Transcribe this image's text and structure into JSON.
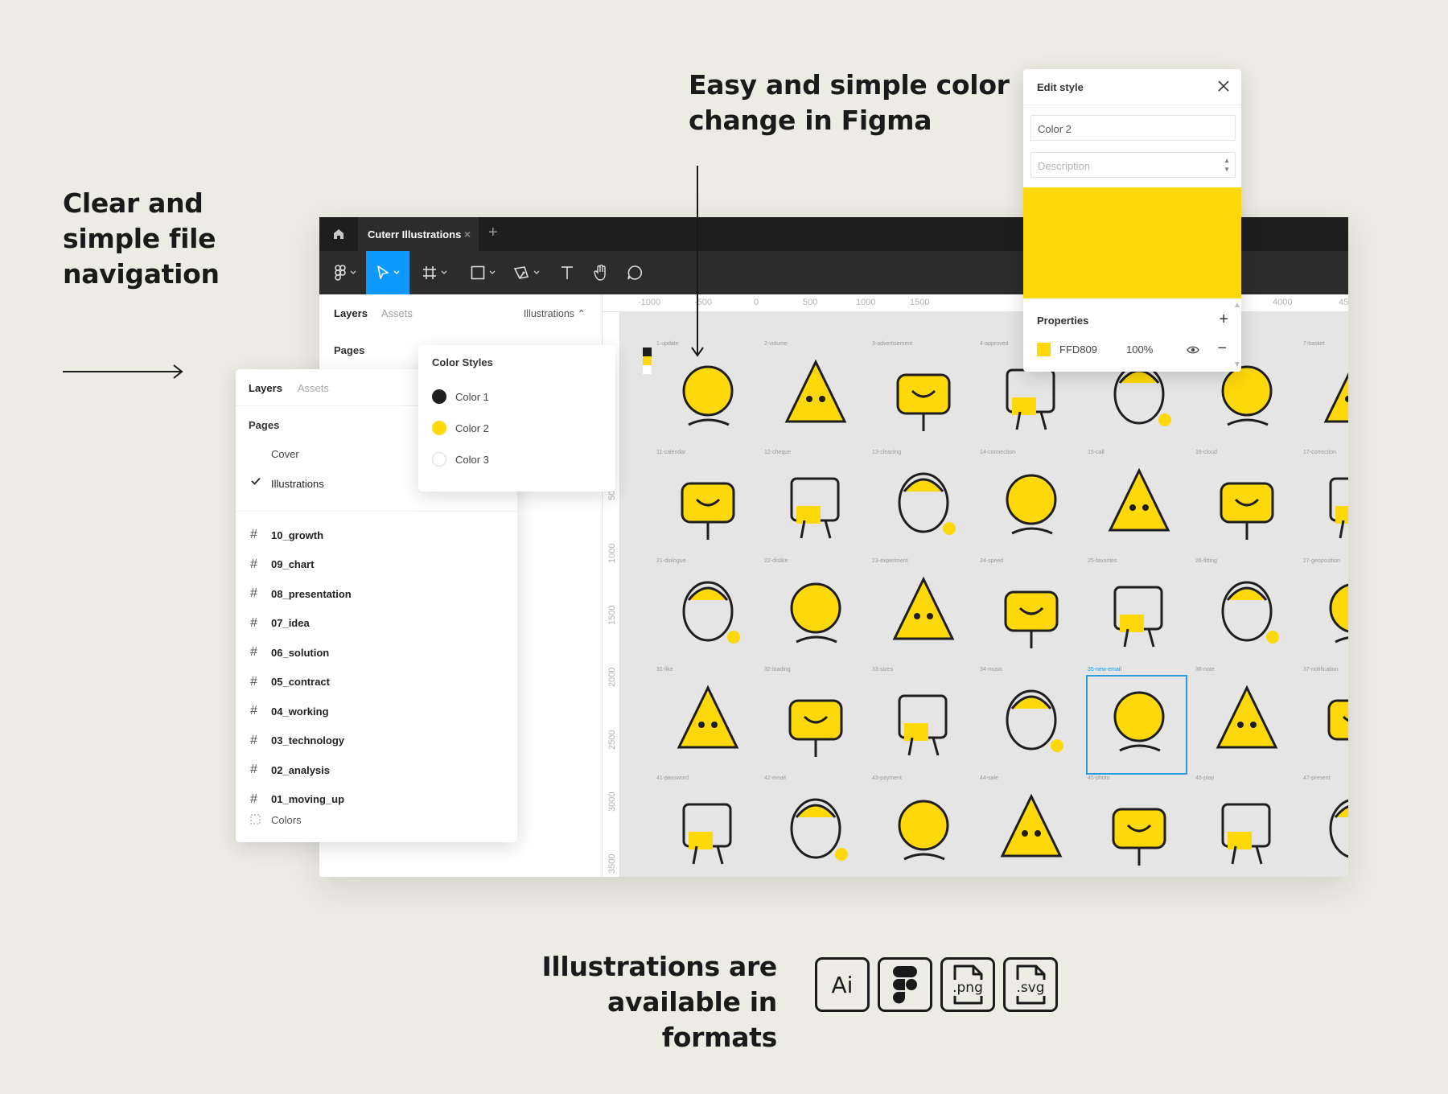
{
  "headlines": {
    "nav": [
      "Clear and",
      "simple file",
      "navigation"
    ],
    "color": [
      "Easy and simple color",
      "change in Figma"
    ],
    "formats": [
      "Illustrations are",
      "available in formats"
    ]
  },
  "window": {
    "tab_title": "Cuterr Illustrations",
    "tab_close": "×",
    "tab_add": "+",
    "left_panel": {
      "tab_layers": "Layers",
      "tab_assets": "Assets",
      "page_selector": "Illustrations ⌃",
      "pages_heading": "Pages"
    },
    "ruler_top": [
      "-1000",
      "-500",
      "0",
      "500",
      "1000",
      "1500",
      "4000",
      "45"
    ],
    "ruler_left": [
      "500",
      "1000",
      "1500",
      "2000",
      "2500",
      "3000",
      "3500"
    ]
  },
  "canvas": {
    "swatch_colors": [
      "#1e1e1e",
      "#ffd809",
      "#ffffff"
    ],
    "cells": [
      "1-update",
      "2-volume",
      "3-advertisement",
      "4-approved",
      "",
      "",
      "7-basket",
      "11-calendar",
      "12-cheque",
      "13-cleaning",
      "14-connection",
      "15-call",
      "16-cloud",
      "17-correction",
      "21-dialogue",
      "22-dislike",
      "23-experiment",
      "24-speed",
      "25-favorites",
      "26-fitting",
      "27-geoposition",
      "31-like",
      "32-loading",
      "33-sizes",
      "34-music",
      "35-new-email",
      "36-note",
      "37-notification",
      "41-password",
      "42-email",
      "43-payment",
      "44-sale",
      "45-photo",
      "46-play",
      "47-present"
    ],
    "selected_index": 25
  },
  "layers_card": {
    "tab_layers": "Layers",
    "tab_assets": "Assets",
    "pages_heading": "Pages",
    "pages": [
      "Cover",
      "Illustrations"
    ],
    "frames": [
      "10_growth",
      "09_chart",
      "08_presentation",
      "07_idea",
      "06_solution",
      "05_contract",
      "04_working",
      "03_technology",
      "02_analysis",
      "01_moving_up"
    ],
    "colors_item": "Colors"
  },
  "color_styles": {
    "title": "Color Styles",
    "items": [
      {
        "label": "Color 1",
        "color": "#1e1e1e"
      },
      {
        "label": "Color 2",
        "color": "#ffd809"
      },
      {
        "label": "Color 3",
        "color": "#ffffff"
      }
    ]
  },
  "edit_style": {
    "title": "Edit style",
    "name_value": "Color 2",
    "description_placeholder": "Description",
    "properties_heading": "Properties",
    "fill_hex": "FFD809",
    "fill_opacity": "100%",
    "swatch_color": "#ffd809"
  },
  "formats": [
    {
      "label": "Ai",
      "kind": "text"
    },
    {
      "label": "figma-icon",
      "kind": "figma"
    },
    {
      "label": ".png",
      "kind": "doc"
    },
    {
      "label": ".svg",
      "kind": "doc"
    }
  ],
  "colors": {
    "accent": "#0d99ff",
    "brand_yellow": "#ffd809",
    "background": "#edece4",
    "dark": "#1e1e1e"
  }
}
